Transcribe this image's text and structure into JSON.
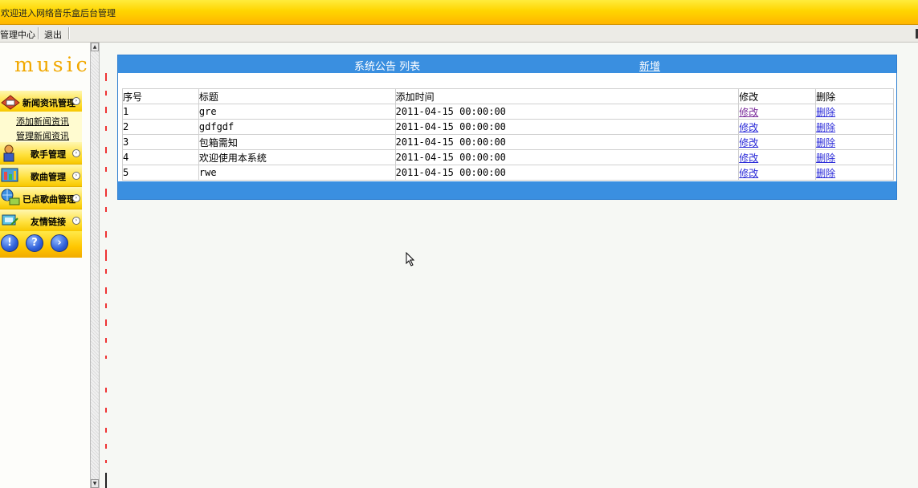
{
  "window": {
    "title": "欢迎进入网络音乐盒后台管理"
  },
  "menubar": {
    "items": [
      "管理中心",
      "退出"
    ]
  },
  "sidebar": {
    "logo": "music",
    "sections": [
      {
        "label": "新闻资讯管理",
        "icon": "news-icon"
      },
      {
        "label": "歌手管理",
        "icon": "singer-icon"
      },
      {
        "label": "歌曲管理",
        "icon": "song-icon"
      },
      {
        "label": "已点歌曲管理",
        "icon": "globe-computer-icon"
      },
      {
        "label": "友情链接",
        "icon": "link-icon"
      }
    ],
    "sublinks": [
      "添加新闻资讯",
      "管理新闻资讯"
    ],
    "bottom_icons": [
      {
        "glyph": "!",
        "icon": "info-icon"
      },
      {
        "glyph": "?",
        "icon": "help-icon"
      },
      {
        "glyph": "›",
        "icon": "forward-icon"
      }
    ]
  },
  "panel": {
    "caption": "系统公告 列表",
    "add_label": "新增",
    "columns": [
      "序号",
      "标题",
      "添加时间",
      "修改",
      "删除"
    ],
    "rows": [
      {
        "id": "1",
        "title": "gre",
        "time": "2011-04-15 00:00:00",
        "edit": "修改",
        "delete": "删除"
      },
      {
        "id": "2",
        "title": "gdfgdf",
        "time": "2011-04-15 00:00:00",
        "edit": "修改",
        "delete": "删除"
      },
      {
        "id": "3",
        "title": "包箱需知",
        "time": "2011-04-15 00:00:00",
        "edit": "修改",
        "delete": "删除"
      },
      {
        "id": "4",
        "title": "欢迎使用本系统",
        "time": "2011-04-15 00:00:00",
        "edit": "修改",
        "delete": "删除"
      },
      {
        "id": "5",
        "title": "rwe",
        "time": "2011-04-15 00:00:00",
        "edit": "修改",
        "delete": "删除"
      }
    ]
  },
  "colors": {
    "header_blue": "#3a8fe0",
    "topbar_yellow": "#ffd500",
    "logo_orange": "#f1a800"
  }
}
